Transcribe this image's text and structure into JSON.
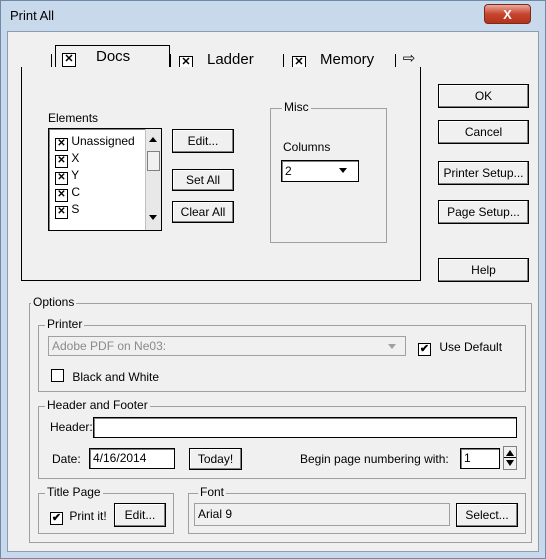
{
  "window": {
    "title": "Print All",
    "close_glyph": "X"
  },
  "tabs": [
    {
      "label": "Docs",
      "checked": true
    },
    {
      "label": "Ladder",
      "checked": true
    },
    {
      "label": "Memory",
      "checked": true
    }
  ],
  "check_glyph": "✕",
  "tab_scroll_icon": "⇨",
  "elements": {
    "label": "Elements",
    "items": [
      "Unassigned",
      "X",
      "Y",
      "C",
      "S"
    ],
    "edit_label": "Edit...",
    "set_all_label": "Set All",
    "clear_all_label": "Clear All"
  },
  "misc": {
    "label": "Misc",
    "columns_label": "Columns",
    "columns_value": "2"
  },
  "side_buttons": {
    "ok": "OK",
    "cancel": "Cancel",
    "printer_setup": "Printer Setup...",
    "page_setup": "Page Setup...",
    "help": "Help"
  },
  "options": {
    "label": "Options",
    "printer": {
      "label": "Printer",
      "selected": "Adobe PDF on Ne03:",
      "use_default_label": "Use Default",
      "use_default": true,
      "bw_label": "Black and White",
      "bw": false
    },
    "header_footer": {
      "label": "Header and Footer",
      "header_label": "Header:",
      "header_value": "",
      "date_label": "Date:",
      "date_value": "4/16/2014",
      "today_label": "Today!",
      "numbering_label": "Begin page numbering with:",
      "numbering_value": "1"
    },
    "title_page": {
      "label": "Title Page",
      "print_it_label": "Print it!",
      "print_it": true,
      "edit_label": "Edit..."
    },
    "font": {
      "label": "Font",
      "value": "Arial 9",
      "select_label": "Select..."
    }
  }
}
